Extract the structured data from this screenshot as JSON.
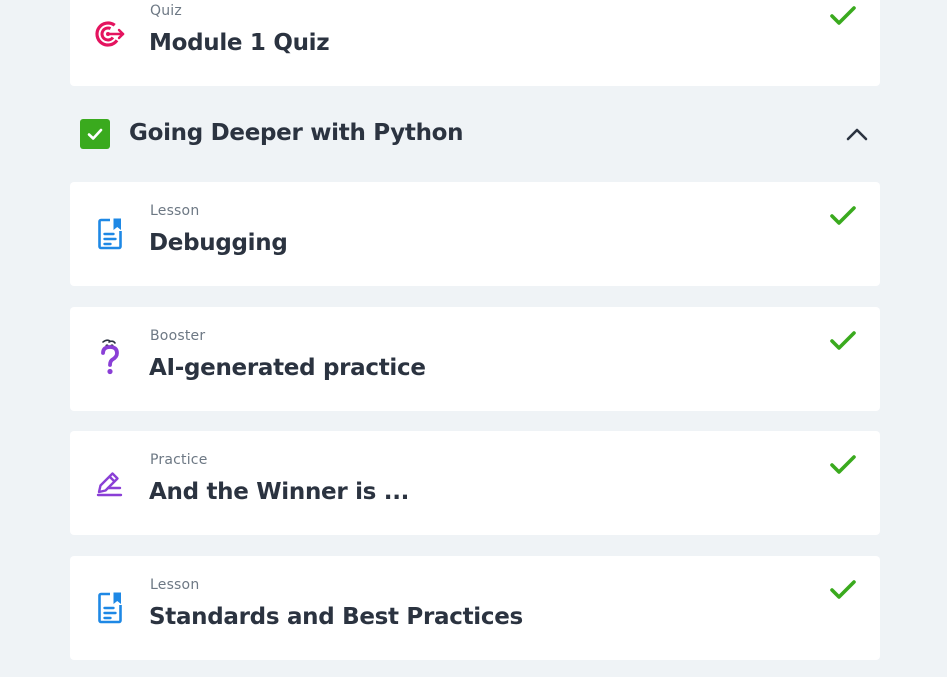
{
  "colors": {
    "background": "#eff3f6",
    "card": "#ffffff",
    "check_green": "#3aaa1e",
    "text_dark": "#2b3340",
    "text_muted": "#6d7884",
    "quiz_icon": "#e4145f",
    "lesson_icon": "#1e88e5",
    "booster_icon": "#8a3fd6",
    "practice_icon": "#8a3fd6"
  },
  "previous_items": [
    {
      "type": "Quiz",
      "title": "Module 1 Quiz",
      "icon": "target-icon",
      "completed": true
    }
  ],
  "section": {
    "title": "Going Deeper with Python",
    "completed": true,
    "expanded": true,
    "toggle_icon": "chevron-up-icon"
  },
  "items": [
    {
      "type": "Lesson",
      "title": "Debugging",
      "icon": "lesson-icon",
      "completed": true
    },
    {
      "type": "Booster",
      "title": "AI-generated practice",
      "icon": "question-mark-icon",
      "completed": true
    },
    {
      "type": "Practice",
      "title": "And the Winner is ...",
      "icon": "pencil-icon",
      "completed": true
    },
    {
      "type": "Lesson",
      "title": "Standards and Best Practices",
      "icon": "lesson-icon",
      "completed": true
    }
  ]
}
